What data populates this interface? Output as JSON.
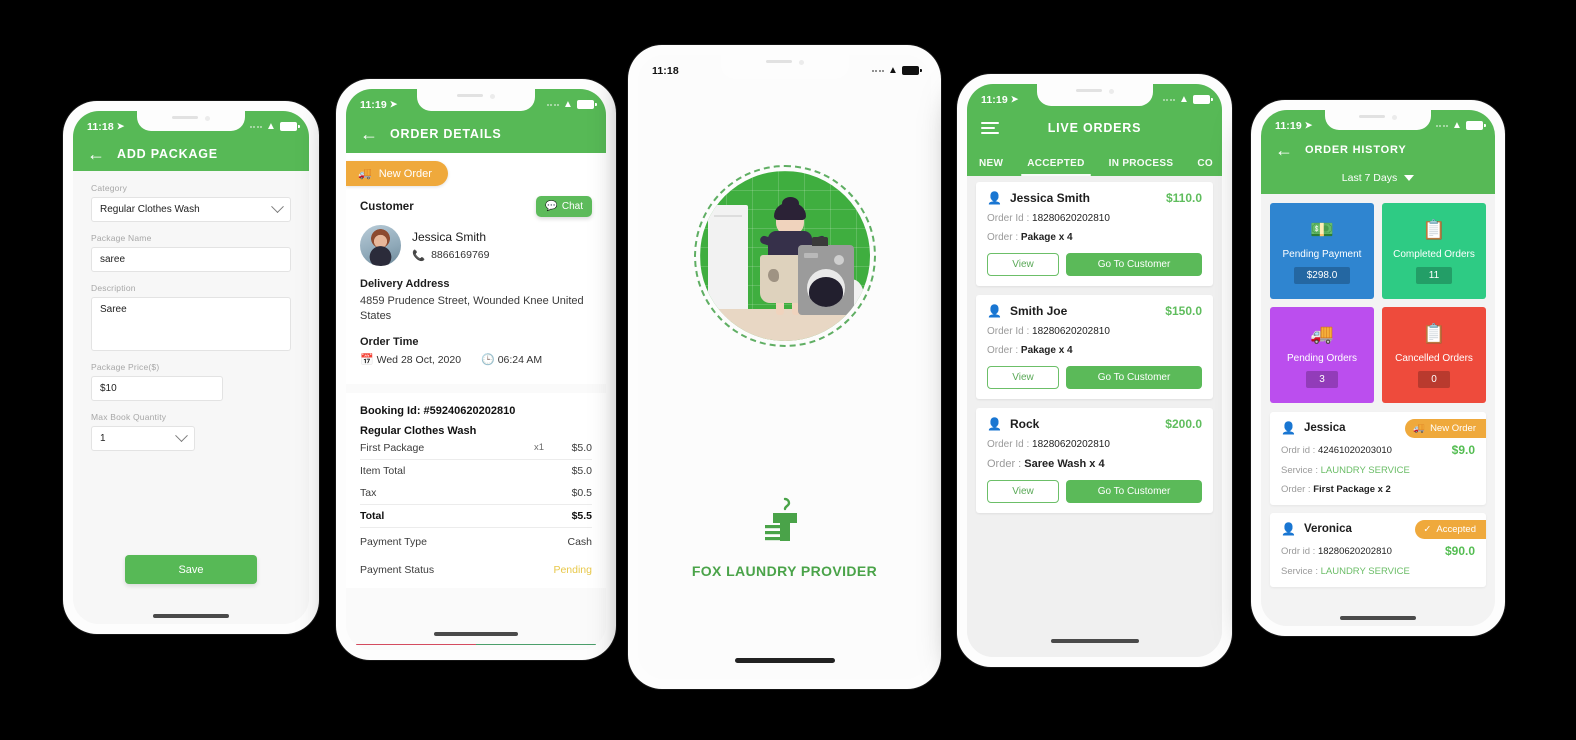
{
  "phones": {
    "add_package": {
      "status": {
        "time": "11:18",
        "loc_icon": "location-arrow-icon",
        "wifi_icon": "wifi-icon",
        "battery_icon": "battery-icon"
      },
      "appbar": {
        "back_icon": "back-arrow-icon",
        "title": "ADD PACKAGE"
      },
      "fields": [
        {
          "label": "Category",
          "value": "Regular Clothes Wash",
          "type": "select"
        },
        {
          "label": "Package Name",
          "value": "saree",
          "type": "text"
        },
        {
          "label": "Description",
          "value": "Saree",
          "type": "textarea"
        },
        {
          "label": "Package Price($)",
          "value": "$10",
          "type": "text"
        },
        {
          "label": "Max Book Quantity",
          "value": "1",
          "type": "select"
        }
      ],
      "save_label": "Save"
    },
    "order_details": {
      "status": {
        "time": "11:19"
      },
      "appbar": {
        "back_icon": "back-arrow-icon",
        "title": "ORDER DETAILS"
      },
      "badge": {
        "label": "New Order",
        "icon": "new-order-icon"
      },
      "customer_heading": "Customer",
      "chat_label": "Chat",
      "chat_icon": "chat-bubble-icon",
      "customer_name": "Jessica Smith",
      "customer_phone": "8866169769",
      "phone_icon": "phone-icon",
      "delivery_heading": "Delivery Address",
      "delivery_address": "4859 Prudence Street, Wounded Knee United States",
      "order_time_heading": "Order Time",
      "order_date": "Wed 28 Oct, 2020",
      "order_time": "06:24 AM",
      "calendar_icon": "calendar-icon",
      "clock_icon": "clock-icon",
      "booking_id": "Booking Id: #59240620202810",
      "category": "Regular Clothes Wash",
      "items": [
        {
          "name": "First Package",
          "qty": "x1",
          "value": "$5.0"
        }
      ],
      "totals": [
        {
          "name": "Item Total",
          "value": "$5.0"
        },
        {
          "name": "Tax",
          "value": "$0.5"
        }
      ],
      "grand_total": {
        "name": "Total",
        "value": "$5.5"
      },
      "payment_type": {
        "label": "Payment Type",
        "value": "Cash"
      },
      "payment_status": {
        "label": "Payment Status",
        "value": "Pending"
      }
    },
    "splash": {
      "status": {
        "time": "11:18"
      },
      "app_name": "FOX LAUNDRY PROVIDER",
      "logo_icon": "laundry-hanger-shirt-icon",
      "illustration": "woman-holding-stained-cloth-washing-machine-illustration"
    },
    "live_orders": {
      "status": {
        "time": "11:19"
      },
      "appbar": {
        "menu_icon": "hamburger-menu-icon",
        "title": "LIVE ORDERS"
      },
      "tabs": [
        {
          "label": "NEW",
          "active": false
        },
        {
          "label": "ACCEPTED",
          "active": true
        },
        {
          "label": "IN PROCESS",
          "active": false
        },
        {
          "label": "CO",
          "active": false
        }
      ],
      "order_id_label": "Order Id :",
      "order_label": "Order :",
      "view_label": "View",
      "go_to_customer_label": "Go To Customer",
      "user_icon": "user-icon",
      "orders": [
        {
          "name": "Jessica Smith",
          "amount": "$110.0",
          "order_id": "18280620202810",
          "order": "Pakage x 4",
          "bold": false
        },
        {
          "name": "Smith Joe",
          "amount": "$150.0",
          "order_id": "18280620202810",
          "order": "Pakage x 4",
          "bold": false
        },
        {
          "name": "Rock",
          "amount": "$200.0",
          "order_id": "18280620202810",
          "order": "Saree Wash x 4",
          "bold": true
        }
      ]
    },
    "order_history": {
      "status": {
        "time": "11:19"
      },
      "appbar": {
        "back_icon": "back-arrow-icon",
        "title": "ORDER HISTORY"
      },
      "range_filter": {
        "label": "Last 7 Days",
        "icon": "chevron-down-icon"
      },
      "tiles": [
        {
          "label": "Pending Payment",
          "value": "$298.0",
          "color": "#2f85d0",
          "icon": "money-wallet-icon"
        },
        {
          "label": "Completed Orders",
          "value": "11",
          "color": "#2ecb84",
          "icon": "document-check-icon"
        },
        {
          "label": "Pending Orders",
          "value": "3",
          "color": "#bb4eee",
          "icon": "hand-package-icon"
        },
        {
          "label": "Cancelled Orders",
          "value": "0",
          "color": "#ee4b3c",
          "icon": "document-x-icon"
        }
      ],
      "order_id_label": "Ordr id :",
      "service_label": "Service :",
      "order_label": "Order  :",
      "user_icon": "user-icon",
      "history": [
        {
          "name": "Jessica",
          "badge": "New Order",
          "badge_icon": "new-order-icon",
          "order_id": "42461020203010",
          "amount": "$9.0",
          "service": "LAUNDRY SERVICE",
          "order": "First Package x 2"
        },
        {
          "name": "Veronica",
          "badge": "Accepted",
          "badge_icon": "check-circle-icon",
          "order_id": "18280620202810",
          "amount": "$90.0",
          "service": "LAUNDRY SERVICE",
          "order": ""
        }
      ]
    }
  },
  "colors": {
    "brand_green": "#57b956",
    "accent_orange": "#efa93c",
    "pending_yellow": "#e8c84a",
    "amount_green": "#5fbd5d"
  }
}
